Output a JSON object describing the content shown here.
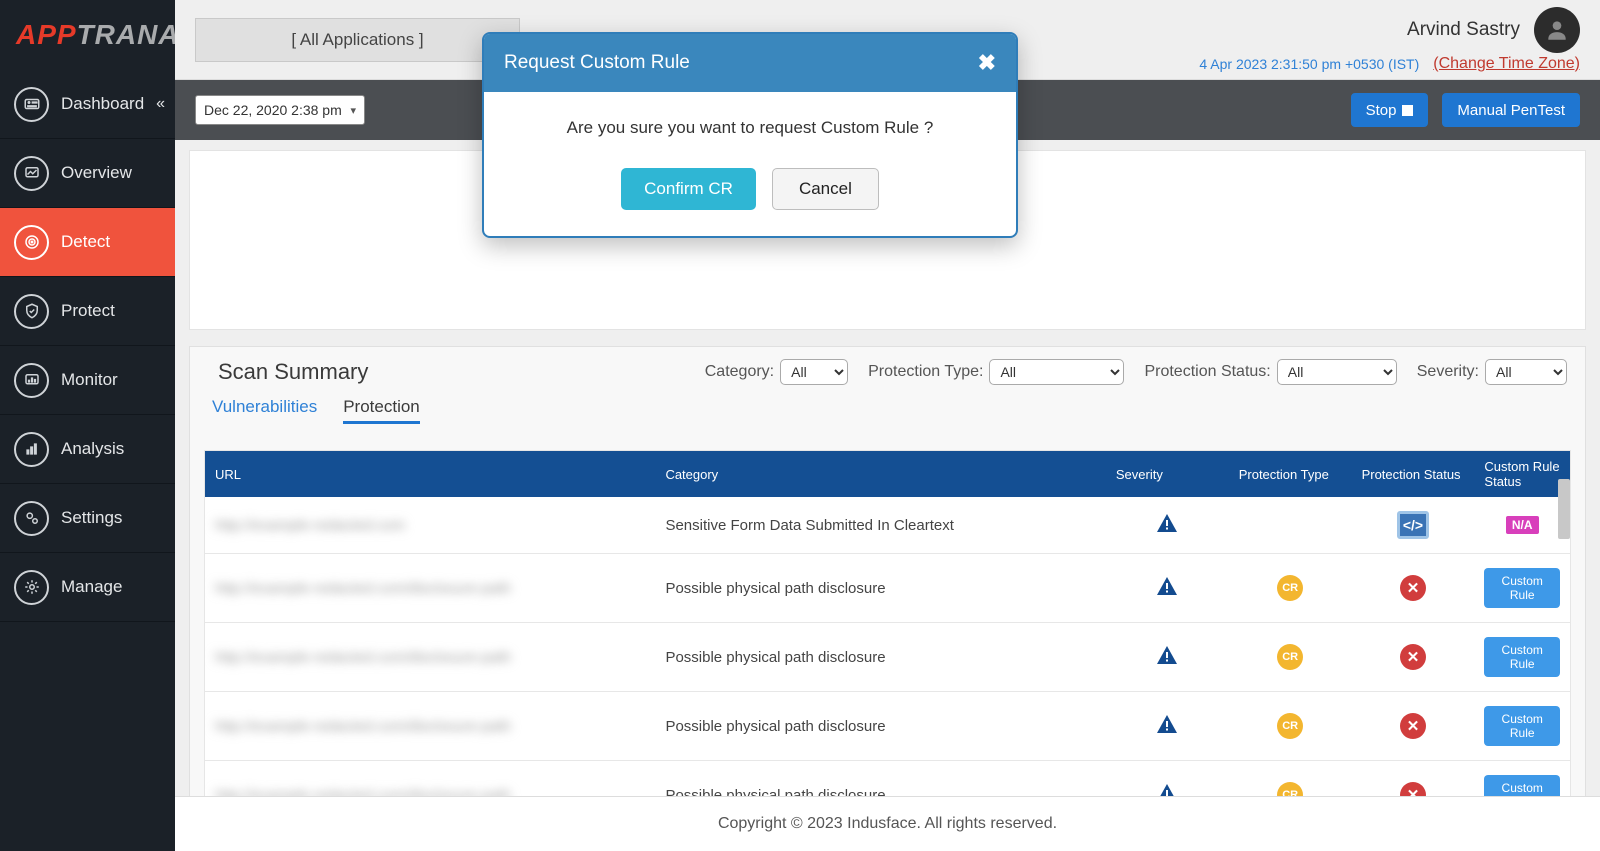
{
  "brand": {
    "part1": "APP",
    "part2": "TRANA"
  },
  "sidebar": {
    "items": [
      {
        "label": "Dashboard",
        "icon": "dashboard",
        "chev": true
      },
      {
        "label": "Overview",
        "icon": "overview"
      },
      {
        "label": "Detect",
        "icon": "detect",
        "active": true
      },
      {
        "label": "Protect",
        "icon": "protect"
      },
      {
        "label": "Monitor",
        "icon": "monitor"
      },
      {
        "label": "Analysis",
        "icon": "analysis"
      },
      {
        "label": "Settings",
        "icon": "settings"
      },
      {
        "label": "Manage",
        "icon": "manage"
      }
    ]
  },
  "header": {
    "appSelector": "[ All Applications ]",
    "userName": "Arvind Sastry",
    "timestamp": "4 Apr 2023 2:31:50 pm +0530 (IST)",
    "tzLabel": "(Change Time Zone)"
  },
  "toolbar": {
    "dateValue": "Dec 22, 2020 2:38 pm",
    "stopLabel": "Stop",
    "pentestLabel": "Manual PenTest"
  },
  "scanSummary": {
    "title": "Scan Summary",
    "filters": {
      "category": {
        "label": "Category:",
        "value": "All"
      },
      "protectionType": {
        "label": "Protection Type:",
        "value": "All"
      },
      "protectionStatus": {
        "label": "Protection Status:",
        "value": "All"
      },
      "severity": {
        "label": "Severity:",
        "value": "All"
      }
    },
    "tabs": {
      "vuln": "Vulnerabilities",
      "protection": "Protection"
    },
    "columns": {
      "url": "URL",
      "category": "Category",
      "severity": "Severity",
      "pt": "Protection Type",
      "ps": "Protection Status",
      "crs": "Custom Rule Status"
    },
    "rows": [
      {
        "url": "http://example-redacted.com",
        "category": "Sensitive Form Data Submitted In Cleartext",
        "pt": "code",
        "ps": "",
        "cr": "N/A"
      },
      {
        "url": "http://example-redacted.com/disclosure-path",
        "category": "Possible physical path disclosure",
        "pt": "cr",
        "ps": "x",
        "cr": "Custom Rule"
      },
      {
        "url": "http://example-redacted.com/disclosure-path",
        "category": "Possible physical path disclosure",
        "pt": "cr",
        "ps": "x",
        "cr": "Custom Rule"
      },
      {
        "url": "http://example-redacted.com/disclosure-path",
        "category": "Possible physical path disclosure",
        "pt": "cr",
        "ps": "x",
        "cr": "Custom Rule"
      },
      {
        "url": "http://example-redacted.com/disclosure-path",
        "category": "Possible physical path disclosure",
        "pt": "cr",
        "ps": "x",
        "cr": "Custom Rule"
      }
    ]
  },
  "footer": {
    "text": "Copyright © 2023 Indusface. All rights reserved."
  },
  "modal": {
    "title": "Request Custom Rule",
    "message": "Are you sure you want to request Custom Rule ?",
    "confirm": "Confirm CR",
    "cancel": "Cancel"
  }
}
